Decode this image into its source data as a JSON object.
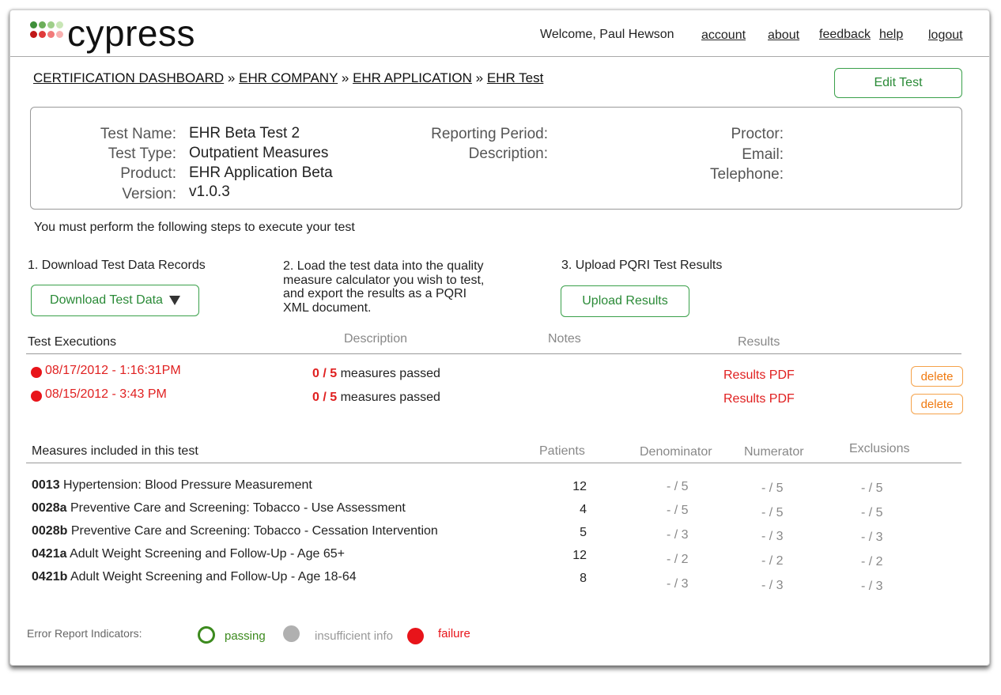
{
  "app": {
    "name": "cypress"
  },
  "header": {
    "welcome": "Welcome, Paul Hewson",
    "links": {
      "account": "account",
      "about": "about",
      "feedback": "feedback",
      "help": "help",
      "logout": "logout"
    }
  },
  "breadcrumb": {
    "items": [
      "CERTIFICATION DASHBOARD",
      "EHR COMPANY",
      "EHR APPLICATION",
      "EHR Test"
    ],
    "separator": "»"
  },
  "edit_button": "Edit Test",
  "test_info": {
    "name_label": "Test Name:",
    "name": "EHR Beta Test 2",
    "type_label": "Test Type:",
    "type": "Outpatient Measures",
    "product_label": "Product:",
    "product": "EHR Application Beta",
    "version_label": "Version:",
    "version": "v1.0.3",
    "reporting_label": "Reporting Period:",
    "description_label": "Description:",
    "proctor_label": "Proctor:",
    "email_label": "Email:",
    "telephone_label": "Telephone:"
  },
  "steps": {
    "intro": "You must perform the following steps to execute your test",
    "step1": "1. Download Test Data Records",
    "step1_button": "Download Test Data",
    "step2_lines": [
      "2. Load the test data into the quality",
      "measure calculator you wish to test,",
      "and export the results as a PQRI",
      "XML document."
    ],
    "step3": "3. Upload PQRI Test Results",
    "step3_button": "Upload Results"
  },
  "executions": {
    "headers": {
      "title": "Test Executions",
      "description": "Description",
      "notes": "Notes",
      "results": "Results"
    },
    "rows": [
      {
        "date": "08/17/2012 - 1:16:31PM",
        "passed": "0 / 5",
        "passed_text": "measures passed",
        "results": "Results PDF",
        "delete": "delete"
      },
      {
        "date": "08/15/2012 - 3:43 PM",
        "passed": "0 / 5",
        "passed_text": "measures passed",
        "results": "Results PDF",
        "delete": "delete"
      }
    ],
    "status_color": "#e8141a"
  },
  "measures": {
    "headers": {
      "title": "Measures included in this test",
      "patients": "Patients",
      "denominator": "Denominator",
      "numerator": "Numerator",
      "exclusions": "Exclusions"
    },
    "rows": [
      {
        "id": "0013",
        "name": "Hypertension: Blood Pressure Measurement",
        "patients": "12",
        "denominator": "- / 5",
        "numerator": "- / 5",
        "exclusions": "- / 5"
      },
      {
        "id": "0028a",
        "name": "Preventive Care and Screening: Tobacco - Use Assessment",
        "patients": "4",
        "denominator": "- / 5",
        "numerator": "- / 5",
        "exclusions": "- / 5"
      },
      {
        "id": "0028b",
        "name": "Preventive Care and Screening: Tobacco - Cessation Intervention",
        "patients": "5",
        "denominator": "- / 3",
        "numerator": "- / 3",
        "exclusions": "- / 3"
      },
      {
        "id": "0421a",
        "name": "Adult Weight Screening and Follow-Up - Age 65+",
        "patients": "12",
        "denominator": "- / 2",
        "numerator": "- / 2",
        "exclusions": "- / 2"
      },
      {
        "id": "0421b",
        "name": "Adult Weight Screening and Follow-Up - Age 18-64",
        "patients": "8",
        "denominator": "- / 3",
        "numerator": "- / 3",
        "exclusions": "- / 3"
      }
    ]
  },
  "legend": {
    "label": "Error Report Indicators:",
    "passing": "passing",
    "insufficient": "insufficient info",
    "failure": "failure",
    "colors": {
      "passing": "#3c8a1e",
      "insufficient": "#b0b0b0",
      "failure": "#e8141a"
    }
  }
}
